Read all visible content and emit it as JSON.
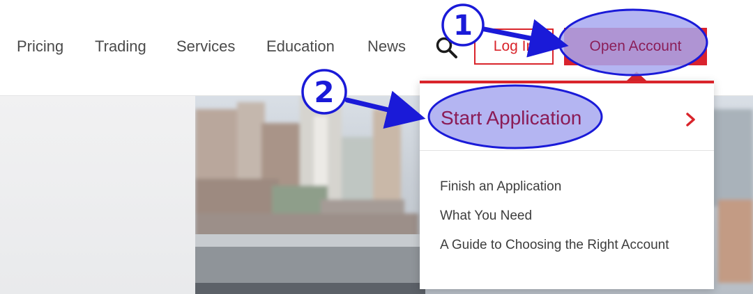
{
  "nav": {
    "items": [
      {
        "id": "pricing",
        "label": "Pricing"
      },
      {
        "id": "trading",
        "label": "Trading"
      },
      {
        "id": "services",
        "label": "Services"
      },
      {
        "id": "education",
        "label": "Education"
      },
      {
        "id": "news",
        "label": "News"
      }
    ],
    "search_icon": "search-icon",
    "login_label": "Log In",
    "open_account_label": "Open Account"
  },
  "dropdown": {
    "primary_label": "Start Application",
    "primary_icon": "chevron-right-icon",
    "links": [
      {
        "label": "Finish an Application"
      },
      {
        "label": "What You Need"
      },
      {
        "label": "A Guide to Choosing the Right Account"
      }
    ]
  },
  "annotations": {
    "step1": "1",
    "step2": "2"
  },
  "colors": {
    "brand_red": "#d9232e",
    "highlight_fill": "#a7a8f0",
    "highlight_stroke": "#1a1ad8",
    "start_app_text": "#8b1c56"
  }
}
